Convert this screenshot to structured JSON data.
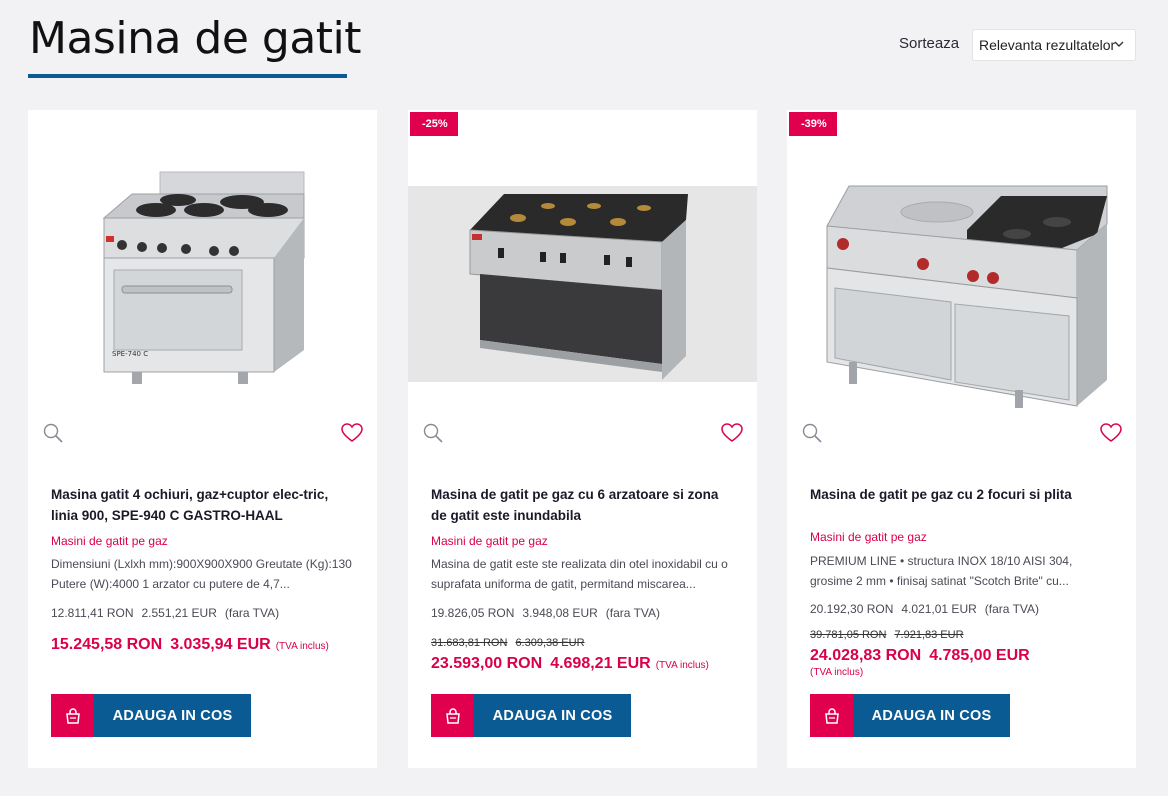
{
  "header": {
    "title": "Masina de gatit",
    "sort_label": "Sorteaza",
    "sort_value": "Relevanta rezultatelor"
  },
  "colors": {
    "accent": "#e0004d",
    "brand_blue": "#0a5a94",
    "background": "#f2f2f4"
  },
  "products": [
    {
      "badge": "",
      "title": "Masina gatit 4 ochiuri, gaz+cuptor elec-tric, linia 900, SPE-940 C GASTRO-HAAL",
      "category": "Masini de gatit pe gaz",
      "description": "Dimensiuni (Lxlxh mm):900X900X900 Greutate (Kg):130 Putere (W):4000 1 arzator cu putere de 4,7...",
      "net_ron": "12.811,41 RON",
      "net_eur": "2.551,21 EUR",
      "net_note": "(fara TVA)",
      "old_ron": "",
      "old_eur": "",
      "price_ron": "15.245,58 RON",
      "price_eur": "3.035,94 EUR",
      "tva_note": "(TVA inclus)",
      "image_label": "SPE-740 C",
      "cart_label": "ADAUGA IN COS"
    },
    {
      "badge": "-25%",
      "title": "Masina de gatit pe gaz cu 6 arzatoare si zona de gatit este inundabila",
      "category": "Masini de gatit pe gaz",
      "description": "Masina de gatit este ste realizata din otel inoxidabil cu o suprafata uniforma de gatit, permitand miscarea...",
      "net_ron": "19.826,05 RON",
      "net_eur": "3.948,08 EUR",
      "net_note": "(fara TVA)",
      "old_ron": "31.683,81 RON",
      "old_eur": "6.309,38 EUR",
      "price_ron": "23.593,00 RON",
      "price_eur": "4.698,21 EUR",
      "tva_note": "(TVA inclus)",
      "cart_label": "ADAUGA IN COS"
    },
    {
      "badge": "-39%",
      "title": "Masina de gatit pe gaz cu 2 focuri si plita",
      "category": "Masini de gatit pe gaz",
      "description": "PREMIUM LINE • structura INOX 18/10 AISI 304, grosime 2 mm • finisaj satinat \"Scotch Brite\" cu...",
      "net_ron": "20.192,30 RON",
      "net_eur": "4.021,01 EUR",
      "net_note": "(fara TVA)",
      "old_ron": "39.781,05 RON",
      "old_eur": "7.921,83 EUR",
      "price_ron": "24.028,83 RON",
      "price_eur": "4.785,00 EUR",
      "tva_note": "(TVA inclus)",
      "cart_label": "ADAUGA IN COS"
    }
  ]
}
